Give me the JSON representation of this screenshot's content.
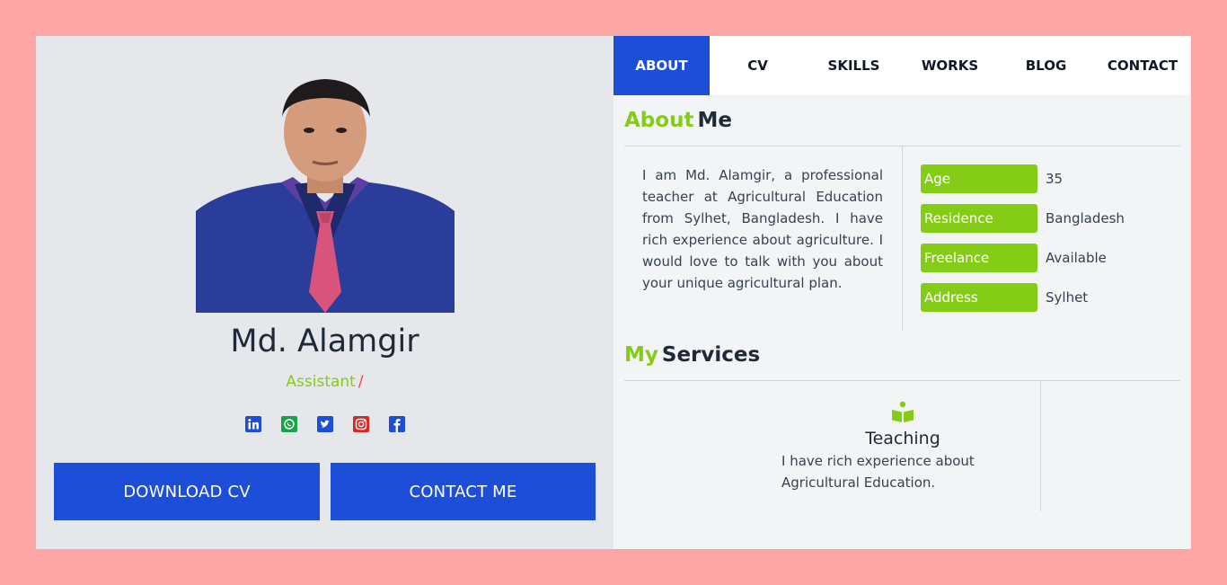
{
  "profile": {
    "name": "Md. Alamgir",
    "role": "Assistant",
    "role_suffix": "/",
    "download_button": "DOWNLOAD CV",
    "contact_button": "CONTACT ME",
    "socials": [
      "linkedin-icon",
      "whatsapp-icon",
      "twitter-icon",
      "instagram-icon",
      "facebook-icon"
    ]
  },
  "nav": {
    "tabs": [
      {
        "label": "ABOUT",
        "active": true
      },
      {
        "label": "CV",
        "active": false
      },
      {
        "label": "SKILLS",
        "active": false
      },
      {
        "label": "WORKS",
        "active": false
      },
      {
        "label": "BLOG",
        "active": false
      },
      {
        "label": "CONTACT",
        "active": false
      }
    ]
  },
  "about": {
    "title_accent": "About",
    "title_rest": "Me",
    "text": "I am Md. Alamgir, a professional teacher at Agricultural Education from Sylhet, Bangladesh. I have rich experience about agriculture. I would love to talk with you about your unique agricultural plan.",
    "info": [
      {
        "label": "Age",
        "value": "35"
      },
      {
        "label": "Residence",
        "value": "Bangladesh"
      },
      {
        "label": "Freelance",
        "value": "Available"
      },
      {
        "label": "Address",
        "value": "Sylhet"
      }
    ]
  },
  "services": {
    "title_accent": "My",
    "title_rest": "Services",
    "items": [
      {
        "icon": "book-reader-icon",
        "title": "Teaching",
        "desc": "I have rich experience about Agricultural Education."
      }
    ]
  },
  "colors": {
    "accent_green": "#84cc16",
    "primary_blue": "#1d4ed8",
    "background": "#fca5a5"
  }
}
